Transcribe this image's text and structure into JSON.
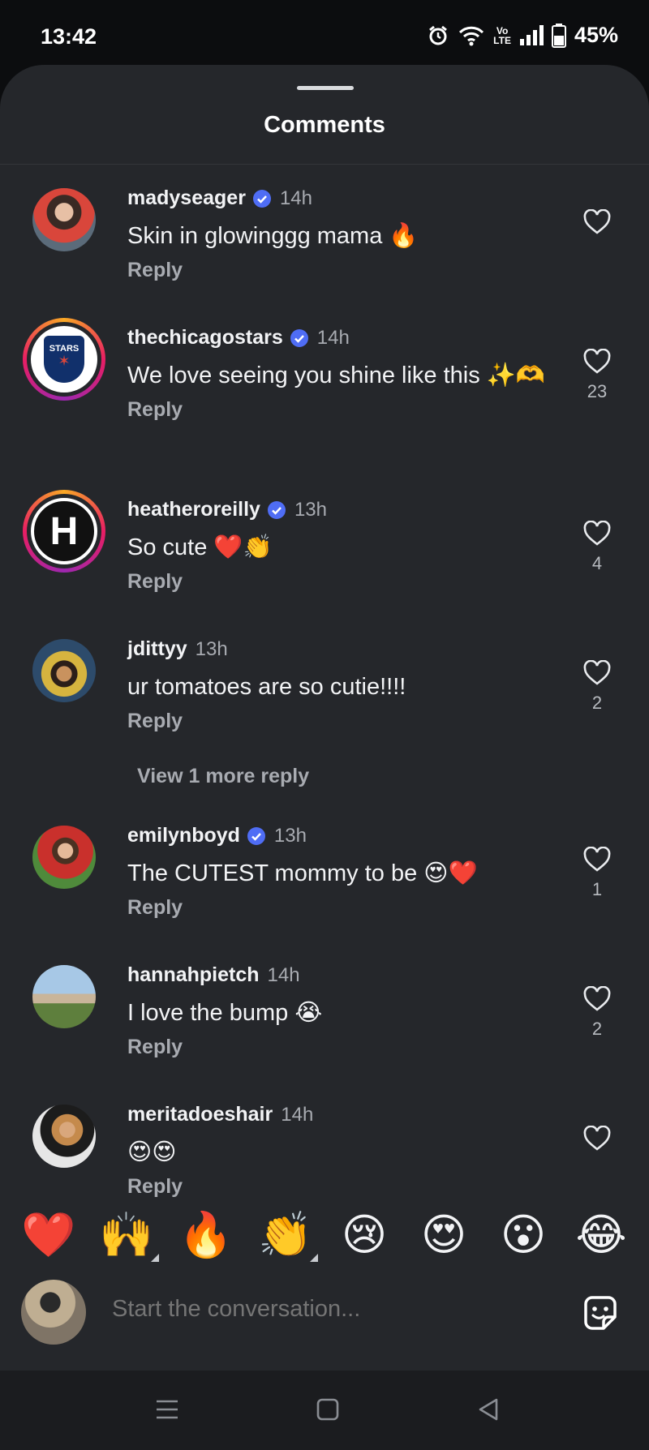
{
  "status_bar": {
    "time": "13:42",
    "volte_line1": "Vo",
    "volte_line2": "LTE",
    "battery": "45%"
  },
  "sheet": {
    "title": "Comments"
  },
  "comments": [
    {
      "user": "madyseager",
      "verified": true,
      "time": "14h",
      "text": "Skin in glowinggg mama 🔥",
      "reply": "Reply",
      "likes": ""
    },
    {
      "user": "thechicagostars",
      "verified": true,
      "time": "14h",
      "text": "We love seeing you shine like this ✨🫶",
      "reply": "Reply",
      "likes": "23",
      "avatar_text": "STARS"
    },
    {
      "user": "heatheroreilly",
      "verified": true,
      "time": "13h",
      "text": "So cute ❤️👏",
      "reply": "Reply",
      "likes": "4",
      "avatar_text": "H"
    },
    {
      "user": "jdittyy",
      "verified": false,
      "time": "13h",
      "text": "ur tomatoes are so cutie!!!!",
      "reply": "Reply",
      "likes": "2"
    },
    {
      "user": "emilynboyd",
      "verified": true,
      "time": "13h",
      "text": "The CUTEST mommy to be 😍❤️",
      "reply": "Reply",
      "likes": "1"
    },
    {
      "user": "hannahpietch",
      "verified": false,
      "time": "14h",
      "text": "I love the bump 😭",
      "reply": "Reply",
      "likes": "2"
    },
    {
      "user": "meritadoeshair",
      "verified": false,
      "time": "14h",
      "text": "😍😍",
      "reply": "Reply",
      "likes": ""
    }
  ],
  "view_more": "View 1 more reply",
  "quick_reactions": [
    "❤️",
    "🙌",
    "🔥",
    "👏",
    "😢",
    "😍",
    "😮",
    "😂"
  ],
  "composer": {
    "placeholder": "Start the conversation..."
  },
  "colors": {
    "sheet_bg": "#25272b",
    "verified": "#4f6df5",
    "muted_text": "#a8abb1"
  },
  "icons": [
    "alarm-icon",
    "wifi-icon",
    "signal-icon",
    "battery-icon",
    "verified-badge-icon",
    "heart-outline-icon",
    "sticker-icon",
    "menu-icon",
    "home-icon",
    "back-icon"
  ]
}
